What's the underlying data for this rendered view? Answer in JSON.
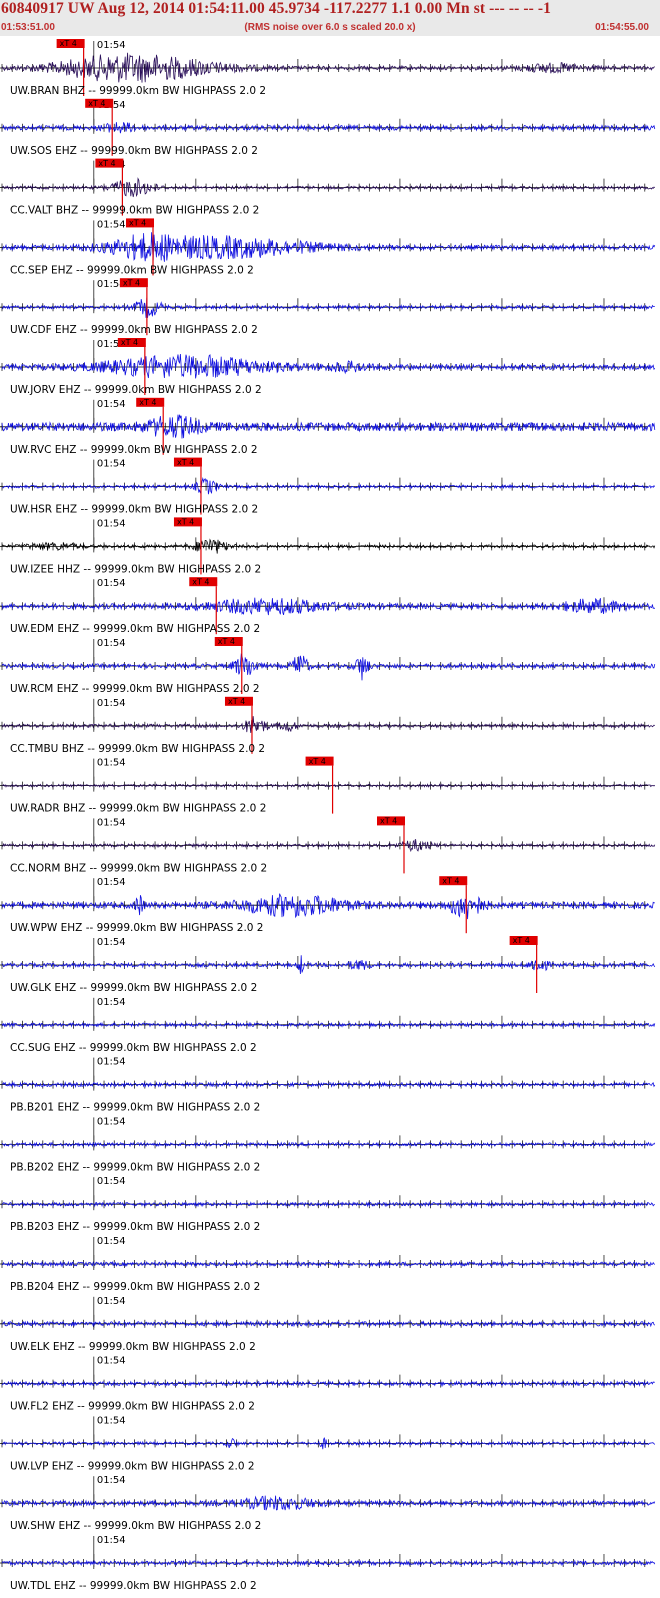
{
  "header": {
    "title": "60840917 UW Aug 12, 2014 01:54:11.00   45.9734 -117.2277  1.1 0.00 Mn st --- -- --  -1",
    "start_time": "01:53:51.00",
    "note": "(RMS noise over 6.0 s scaled 20.0 x)",
    "end_time": "01:54:55.00"
  },
  "colors": {
    "blue": "#1010e0",
    "dark": "#2a0f5a",
    "black": "#000000",
    "pick": "#e00000",
    "title": "#b02020"
  },
  "chart_data": {
    "type": "line",
    "title": "60840917 UW Aug 12, 2014 01:54:11.00   45.9734 -117.2277  1.1 0.00 Mn st --- -- --  -1",
    "x_range": [
      "01:53:51.00",
      "01:54:55.00"
    ],
    "x_range_seconds": [
      0,
      64
    ],
    "minute_tick_label": "01:54",
    "minute_tick_seconds": 9,
    "pick_label": "xT 4",
    "traces": [
      {
        "label": "UW.BRAN BHZ -- 99999.0km BW  HIGHPASS  2.0  2",
        "color": "dark",
        "noise": 0.45,
        "pick_s": 8.0,
        "bursts": [
          {
            "c": 11,
            "w": 6,
            "a": 2.6
          },
          {
            "c": 17,
            "w": 6,
            "a": 1.4
          },
          {
            "c": 54,
            "w": 3,
            "a": 0.9
          }
        ]
      },
      {
        "label": "UW.SOS EHZ -- 99999.0km BW  HIGHPASS  2.0  2",
        "color": "blue",
        "noise": 0.55,
        "pick_s": 10.8,
        "bursts": [
          {
            "c": 11.5,
            "w": 1.5,
            "a": 1.0
          }
        ]
      },
      {
        "label": "CC.VALT BHZ -- 99999.0km BW  HIGHPASS  2.0  2",
        "color": "dark",
        "noise": 0.35,
        "pick_s": 11.8,
        "bursts": [
          {
            "c": 12.8,
            "w": 2.0,
            "a": 2.0
          }
        ]
      },
      {
        "label": "CC.SEP EHZ -- 99999.0km BW  HIGHPASS  2.0  2",
        "color": "blue",
        "noise": 0.55,
        "pick_s": 14.8,
        "bursts": [
          {
            "c": 21,
            "w": 9,
            "a": 2.4
          },
          {
            "c": 14,
            "w": 3,
            "a": 1.8
          }
        ]
      },
      {
        "label": "UW.CDF EHZ -- 99999.0km BW  HIGHPASS  2.0  2",
        "color": "blue",
        "noise": 0.4,
        "pick_s": 14.2,
        "bursts": [
          {
            "c": 14.3,
            "w": 1.2,
            "a": 2.2
          }
        ]
      },
      {
        "label": "UW.JORV EHZ -- 99999.0km BW  HIGHPASS  2.0  2",
        "color": "blue",
        "noise": 0.6,
        "pick_s": 14.0,
        "bursts": [
          {
            "c": 18,
            "w": 8,
            "a": 2.5
          },
          {
            "c": 34,
            "w": 2,
            "a": 0.9
          }
        ]
      },
      {
        "label": "UW.RVC EHZ -- 99999.0km BW  HIGHPASS  2.0  2",
        "color": "blue",
        "noise": 1.0,
        "pick_s": 15.8,
        "bursts": [
          {
            "c": 16.8,
            "w": 2.5,
            "a": 2.2
          }
        ]
      },
      {
        "label": "UW.HSR EHZ -- 99999.0km BW  HIGHPASS  2.0  2",
        "color": "blue",
        "noise": 0.35,
        "pick_s": 19.5,
        "bursts": [
          {
            "c": 20.0,
            "w": 1.0,
            "a": 1.8
          }
        ]
      },
      {
        "label": "UW.IZEE HHZ -- 99999.0km BW  HIGHPASS  2.0  2",
        "color": "black",
        "noise": 0.35,
        "pick_s": 19.5,
        "bursts": [
          {
            "c": 20.4,
            "w": 1.5,
            "a": 1.8
          },
          {
            "c": 5,
            "w": 2.5,
            "a": 0.7
          }
        ]
      },
      {
        "label": "UW.EDM EHZ -- 99999.0km BW  HIGHPASS  2.0  2",
        "color": "blue",
        "noise": 0.6,
        "pick_s": 21.0,
        "bursts": [
          {
            "c": 26,
            "w": 6,
            "a": 1.6
          },
          {
            "c": 58,
            "w": 3,
            "a": 1.4
          }
        ]
      },
      {
        "label": "UW.RCM EHZ -- 99999.0km BW  HIGHPASS  2.0  2",
        "color": "blue",
        "noise": 0.5,
        "pick_s": 23.5,
        "bursts": [
          {
            "c": 23.8,
            "w": 1.0,
            "a": 2.8
          },
          {
            "c": 29.2,
            "w": 0.7,
            "a": 2.8
          },
          {
            "c": 35.3,
            "w": 0.6,
            "a": 3.0
          }
        ]
      },
      {
        "label": "CC.TMBU BHZ -- 99999.0km BW  HIGHPASS  2.0  2",
        "color": "dark",
        "noise": 0.4,
        "pick_s": 24.5,
        "bursts": [
          {
            "c": 24.8,
            "w": 1.0,
            "a": 2.2
          },
          {
            "c": 28.0,
            "w": 0.8,
            "a": 1.2
          }
        ]
      },
      {
        "label": "UW.RADR BHZ -- 99999.0km BW  HIGHPASS  2.0  2",
        "color": "dark",
        "noise": 0.3,
        "pick_s": 32.4,
        "bursts": []
      },
      {
        "label": "CC.NORM BHZ -- 99999.0km BW  HIGHPASS  2.0  2",
        "color": "dark",
        "noise": 0.35,
        "pick_s": 39.4,
        "bursts": [
          {
            "c": 40.5,
            "w": 1.5,
            "a": 1.2
          }
        ]
      },
      {
        "label": "UW.WPW EHZ -- 99999.0km BW  HIGHPASS  2.0  2",
        "color": "blue",
        "noise": 0.7,
        "pick_s": 45.5,
        "bursts": [
          {
            "c": 28.5,
            "w": 5,
            "a": 2.3
          },
          {
            "c": 45.5,
            "w": 1.5,
            "a": 3.0
          },
          {
            "c": 13.5,
            "w": 0.4,
            "a": 2.0
          }
        ]
      },
      {
        "label": "UW.GLK EHZ -- 99999.0km BW  HIGHPASS  2.0  2",
        "color": "blue",
        "noise": 0.45,
        "pick_s": 52.4,
        "bursts": [
          {
            "c": 52.6,
            "w": 0.8,
            "a": 1.8
          },
          {
            "c": 29.3,
            "w": 0.3,
            "a": 2.2
          },
          {
            "c": 35,
            "w": 1.0,
            "a": 1.0
          }
        ]
      },
      {
        "label": "CC.SUG EHZ -- 99999.0km BW  HIGHPASS  2.0  2",
        "color": "blue",
        "noise": 0.4,
        "pick_s": null,
        "bursts": []
      },
      {
        "label": "PB.B201 EHZ -- 99999.0km BW  HIGHPASS  2.0  2",
        "color": "blue",
        "noise": 0.45,
        "pick_s": null,
        "bursts": []
      },
      {
        "label": "PB.B202 EHZ -- 99999.0km BW  HIGHPASS  2.0  2",
        "color": "blue",
        "noise": 0.4,
        "pick_s": null,
        "bursts": []
      },
      {
        "label": "PB.B203 EHZ -- 99999.0km BW  HIGHPASS  2.0  2",
        "color": "blue",
        "noise": 0.4,
        "pick_s": null,
        "bursts": []
      },
      {
        "label": "PB.B204 EHZ -- 99999.0km BW  HIGHPASS  2.0  2",
        "color": "blue",
        "noise": 0.45,
        "pick_s": null,
        "bursts": []
      },
      {
        "label": "UW.ELK EHZ -- 99999.0km BW  HIGHPASS  2.0  2",
        "color": "blue",
        "noise": 0.5,
        "pick_s": null,
        "bursts": []
      },
      {
        "label": "UW.FL2 EHZ -- 99999.0km BW  HIGHPASS  2.0  2",
        "color": "blue",
        "noise": 0.45,
        "pick_s": null,
        "bursts": []
      },
      {
        "label": "UW.LVP EHZ -- 99999.0km BW  HIGHPASS  2.0  2",
        "color": "blue",
        "noise": 0.35,
        "pick_s": null,
        "bursts": [
          {
            "c": 22.5,
            "w": 0.4,
            "a": 1.2
          },
          {
            "c": 31.5,
            "w": 0.3,
            "a": 1.3
          }
        ]
      },
      {
        "label": "UW.SHW EHZ -- 99999.0km BW  HIGHPASS  2.0  2",
        "color": "blue",
        "noise": 0.55,
        "pick_s": null,
        "bursts": [
          {
            "c": 27,
            "w": 3.5,
            "a": 1.4
          }
        ]
      },
      {
        "label": "UW.TDL EHZ -- 99999.0km BW  HIGHPASS  2.0  2",
        "color": "blue",
        "noise": 0.45,
        "pick_s": null,
        "bursts": []
      }
    ]
  }
}
